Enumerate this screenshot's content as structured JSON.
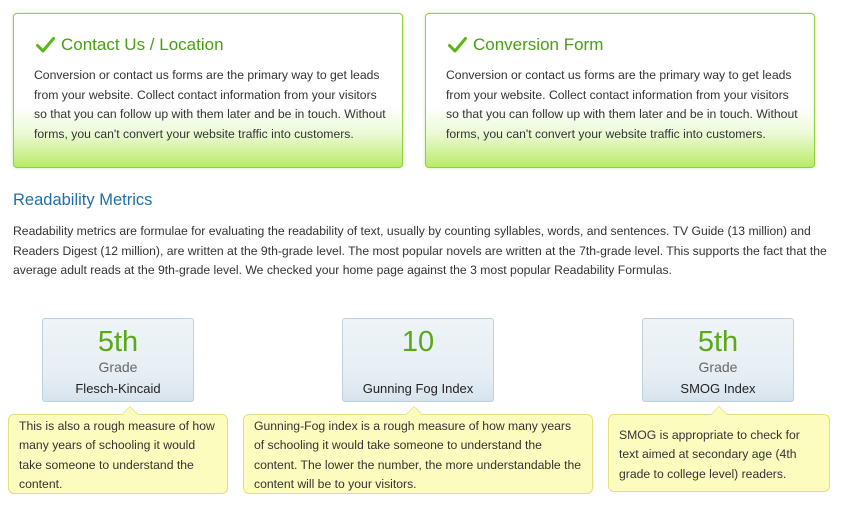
{
  "cards": [
    {
      "title": "Contact Us / Location",
      "icon": "check-icon",
      "body": "Conversion or contact us forms are the primary way to get leads from your website. Collect contact information from your visitors so that you can follow up with them later and be in touch. Without forms, you can't convert your website traffic into customers."
    },
    {
      "title": "Conversion Form",
      "icon": "check-icon",
      "body": "Conversion or contact us forms are the primary way to get leads from your website. Collect contact information from your visitors so that you can follow up with them later and be in touch. Without forms, you can't convert your website traffic into customers."
    }
  ],
  "readability": {
    "title": "Readability Metrics",
    "description": "Readability metrics are formulae for evaluating the readability of text, usually by counting syllables, words, and sentences. TV Guide (13 million) and Readers Digest (12 million), are written at the 9th-grade level. The most popular novels are written at the 7th-grade level. This supports the fact that the average adult reads at the 9th-grade level. We checked your home page against the 3 most popular Readability Formulas.",
    "metrics": [
      {
        "value": "5th",
        "unit": "Grade",
        "name": "Flesch-Kincaid",
        "tip": "This is also a rough measure of how many years of schooling it would take someone to understand the content."
      },
      {
        "value": "10",
        "unit": "",
        "name": "Gunning Fog Index",
        "tip": "Gunning-Fog index is a rough measure of how many years of schooling it would take someone to understand the content. The lower the number, the more understandable the content will be to your visitors."
      },
      {
        "value": "5th",
        "unit": "Grade",
        "name": "SMOG Index",
        "tip": "SMOG is appropriate to check for text aimed at secondary age (4th grade to college level) readers."
      }
    ]
  },
  "colors": {
    "accent_green": "#4a9e12",
    "card_border": "#8fd13a",
    "heading_blue": "#1f6fa8",
    "metric_value": "#5aa817",
    "tip_background": "#fdfcbf"
  }
}
